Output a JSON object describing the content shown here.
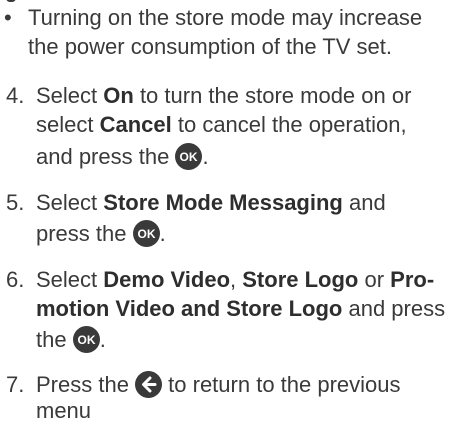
{
  "bullet_note": {
    "marker": "•",
    "line1": "Turning on the store mode may increase",
    "line2": "the power consumption of the TV set."
  },
  "steps": [
    {
      "number": "4.",
      "l1_pre": "Select ",
      "l1_bold": "On",
      "l1_post": " to turn the store mode on or",
      "l2_pre": "select ",
      "l2_bold": "Cancel",
      "l2_post": " to cancel the operation,",
      "l3_pre": "and press the ",
      "l3_post": "."
    },
    {
      "number": "5.",
      "l1_pre": "Select ",
      "l1_bold": "Store Mode Messaging",
      "l1_post": " and",
      "l2_pre": "press the ",
      "l2_post": "."
    },
    {
      "number": "6.",
      "l1_pre": "Select ",
      "l1_bold1": "Demo Video",
      "l1_mid": ", ",
      "l1_bold2": "Store Logo",
      "l1_mid2": " or ",
      "l1_bold3": "Pro-",
      "l2_bold": "motion Video and Store Logo",
      "l2_post": " and press",
      "l3_pre": "the ",
      "l3_post": "."
    },
    {
      "number": "7.",
      "l1_pre": "Press the ",
      "l1_post": " to return to the previous",
      "l2": "menu"
    }
  ],
  "icons": {
    "ok_label": "OK",
    "ok_icon": "ok-button-icon",
    "back_icon": "back-arrow-icon"
  }
}
